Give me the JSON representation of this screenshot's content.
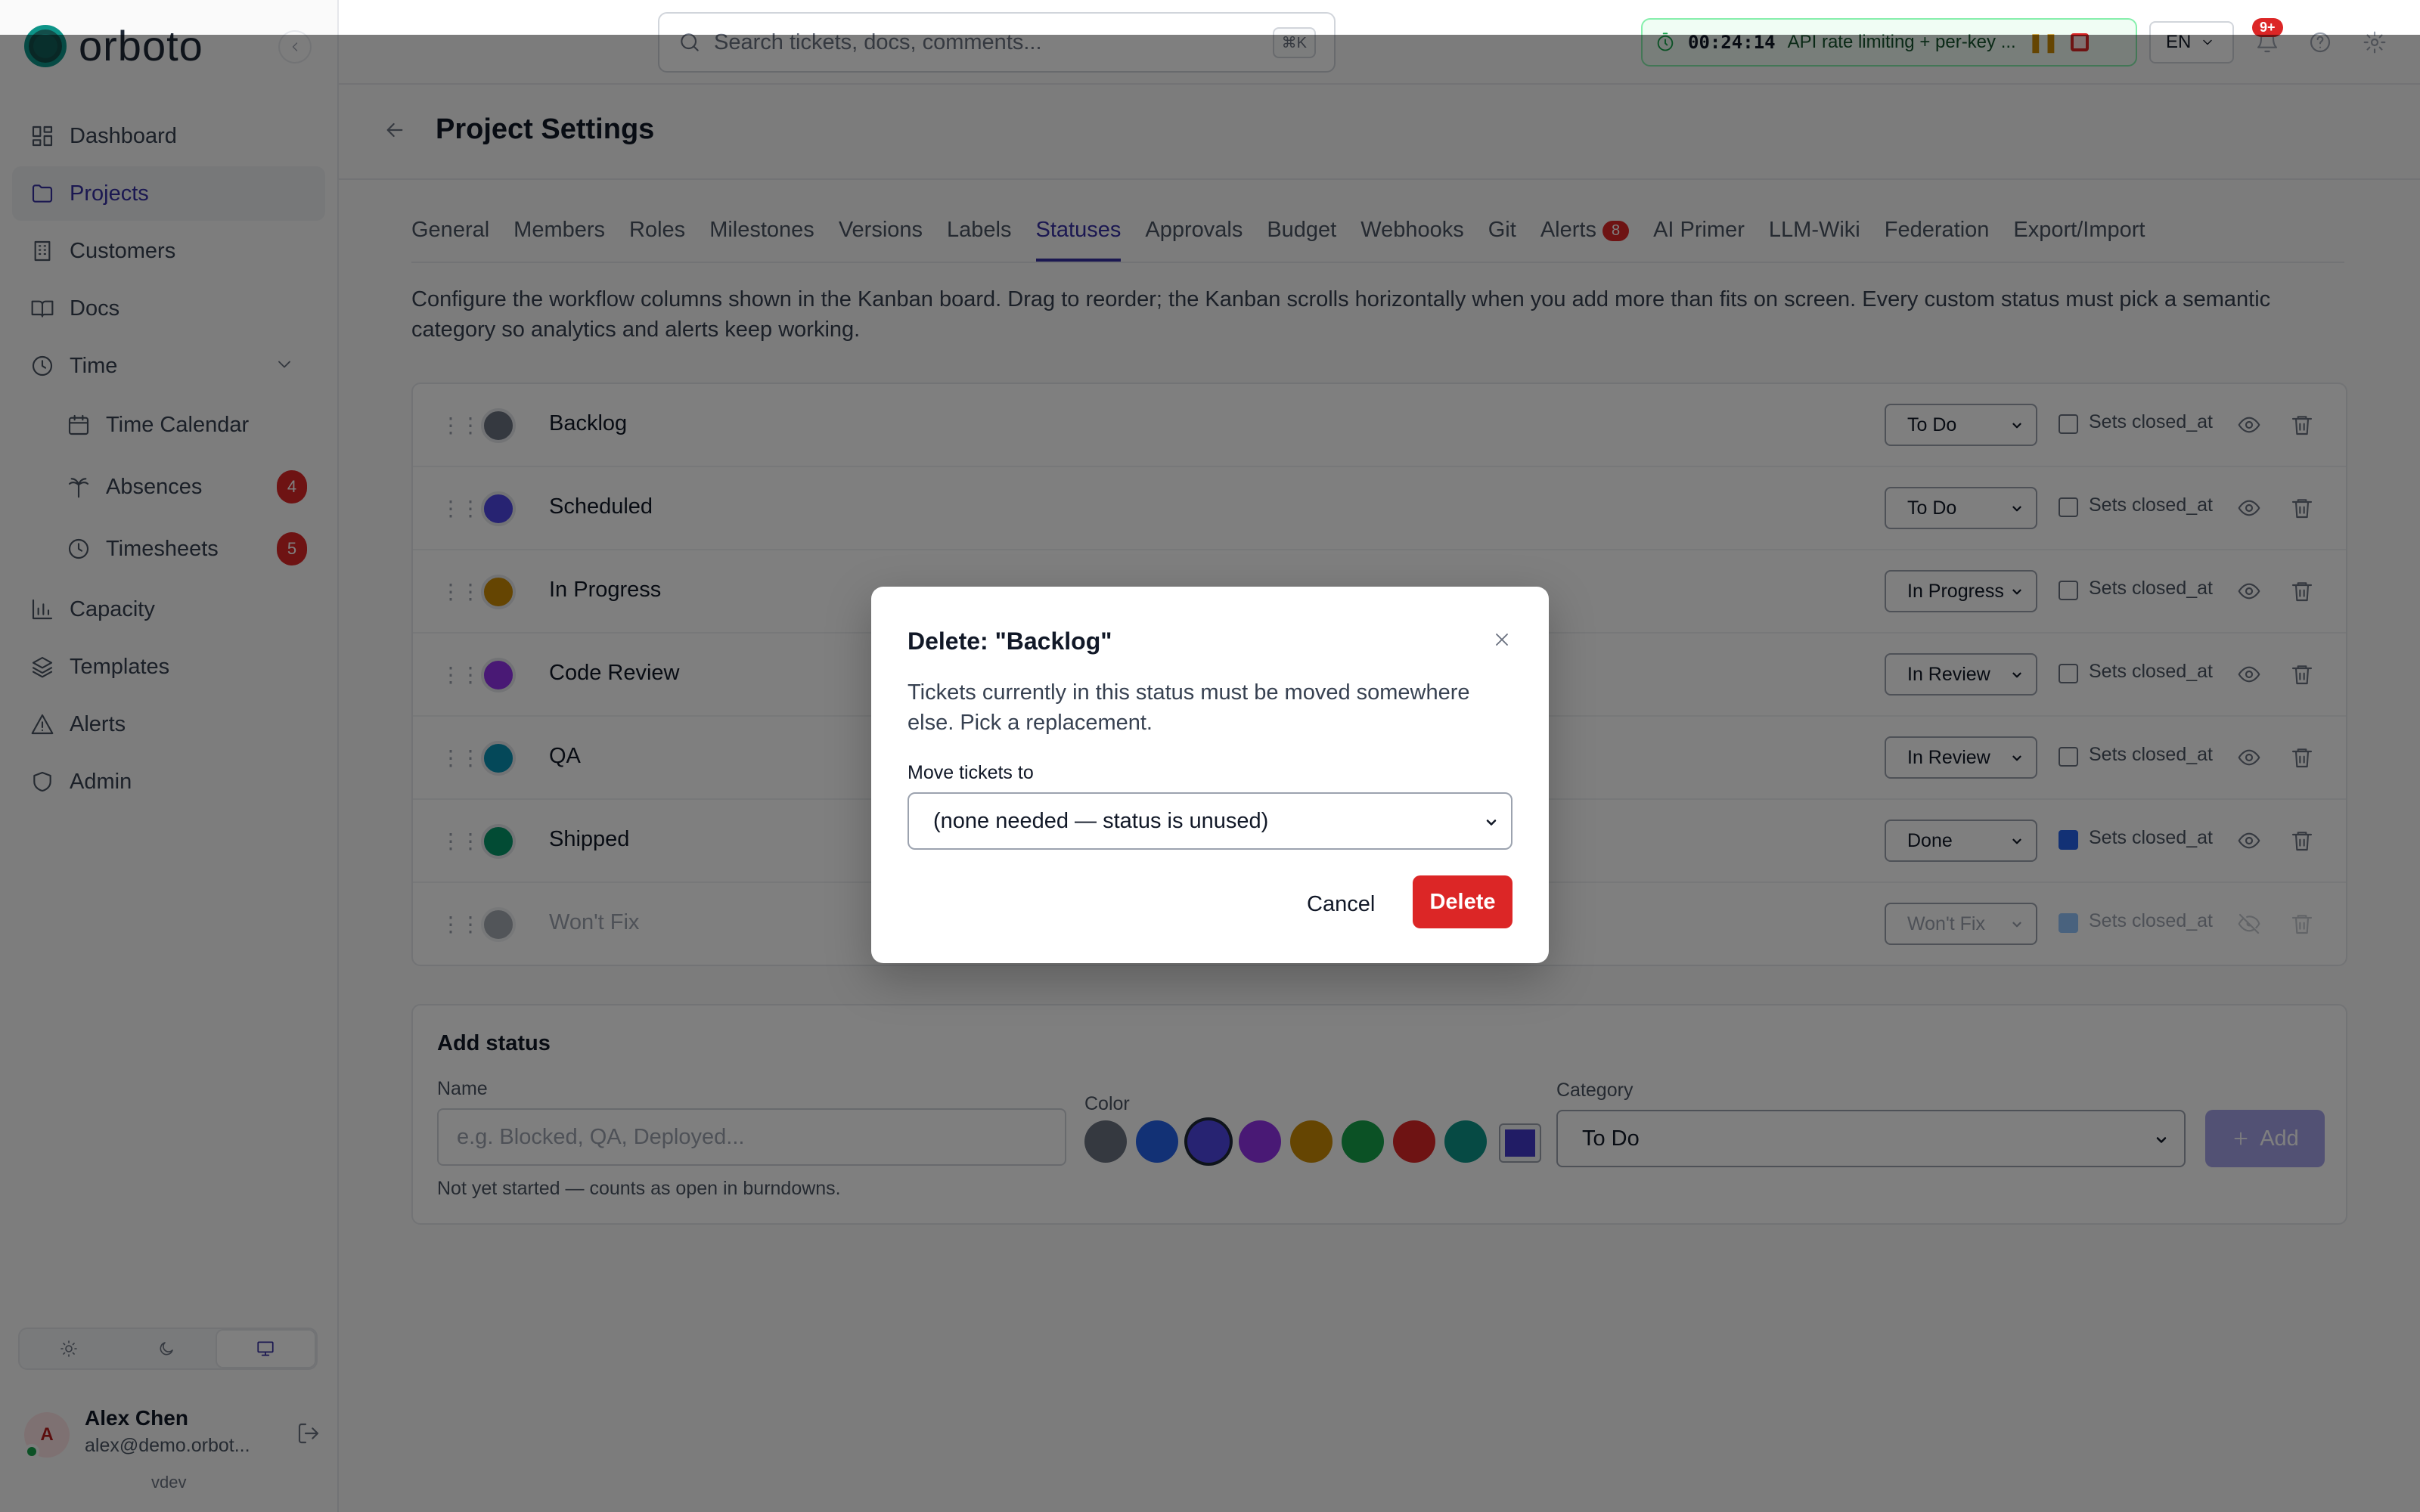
{
  "app": {
    "logo_text": "orboto",
    "version": "vdev"
  },
  "sidebar": {
    "items": [
      {
        "label": "Dashboard",
        "icon": "dashboard-icon"
      },
      {
        "label": "Projects",
        "icon": "folder-icon",
        "active": true
      },
      {
        "label": "Customers",
        "icon": "building-icon"
      },
      {
        "label": "Docs",
        "icon": "book-icon"
      },
      {
        "label": "Time",
        "icon": "clock-icon",
        "expanded": true
      },
      {
        "label": "Time Calendar",
        "icon": "calendar-icon"
      },
      {
        "label": "Absences",
        "icon": "palm-tree-icon",
        "badge": "4"
      },
      {
        "label": "Timesheets",
        "icon": "clock-icon",
        "badge": "5"
      },
      {
        "label": "Capacity",
        "icon": "bar-chart-icon"
      },
      {
        "label": "Templates",
        "icon": "layers-icon"
      },
      {
        "label": "Alerts",
        "icon": "triangle-alert-icon"
      },
      {
        "label": "Admin",
        "icon": "shield-icon"
      }
    ],
    "theme_options": [
      "light",
      "dark",
      "system"
    ],
    "theme_selected": "system",
    "user": {
      "initial": "A",
      "name": "Alex Chen",
      "email": "alex@demo.orbot..."
    }
  },
  "topbar": {
    "search_placeholder": "Search tickets, docs, comments...",
    "search_shortcut": "⌘K",
    "timer": {
      "elapsed": "00:24:14",
      "task": "API rate limiting + per-key ..."
    },
    "language": "EN",
    "notifications_badge": "9+"
  },
  "page": {
    "title": "Project Settings",
    "tabs": [
      {
        "label": "General"
      },
      {
        "label": "Members"
      },
      {
        "label": "Roles"
      },
      {
        "label": "Milestones"
      },
      {
        "label": "Versions"
      },
      {
        "label": "Labels"
      },
      {
        "label": "Statuses",
        "active": true
      },
      {
        "label": "Approvals"
      },
      {
        "label": "Budget"
      },
      {
        "label": "Webhooks"
      },
      {
        "label": "Git"
      },
      {
        "label": "Alerts",
        "count": "8"
      },
      {
        "label": "AI Primer"
      },
      {
        "label": "LLM-Wiki"
      },
      {
        "label": "Federation"
      },
      {
        "label": "Export/Import"
      }
    ],
    "description": "Configure the workflow columns shown in the Kanban board. Drag to reorder; the Kanban scrolls horizontally when you add more than fits on screen. Every custom status must pick a semantic category so analytics and alerts keep working."
  },
  "statuses": {
    "checkbox_label": "Sets closed_at",
    "rows": [
      {
        "name": "Backlog",
        "color": "#6b7280",
        "category": "To Do",
        "closed": false,
        "hidden": false
      },
      {
        "name": "Scheduled",
        "color": "#4f46e5",
        "category": "To Do",
        "closed": false,
        "hidden": false
      },
      {
        "name": "In Progress",
        "color": "#ca8a04",
        "category": "In Progress",
        "closed": false,
        "hidden": false
      },
      {
        "name": "Code Review",
        "color": "#9333ea",
        "category": "In Review",
        "closed": false,
        "hidden": false
      },
      {
        "name": "QA",
        "color": "#0891b2",
        "category": "In Review",
        "closed": false,
        "hidden": false
      },
      {
        "name": "Shipped",
        "color": "#059669",
        "category": "Done",
        "closed": true,
        "hidden": false
      },
      {
        "name": "Won't Fix",
        "color": "#6b7280",
        "category": "Won't Fix",
        "closed": true,
        "hidden": true
      }
    ]
  },
  "add_status": {
    "heading": "Add status",
    "name_label": "Name",
    "name_placeholder": "e.g. Blocked, QA, Deployed...",
    "color_label": "Color",
    "colors": [
      "#6b7280",
      "#2563eb",
      "#4f46e5",
      "#9333ea",
      "#ca8a04",
      "#16a34a",
      "#dc2626",
      "#0d9488"
    ],
    "selected_color": "#4f46e5",
    "custom_color": "#4338ca",
    "category_label": "Category",
    "category_value": "To Do",
    "button_label": "Add",
    "hint": "Not yet started — counts as open in burndowns."
  },
  "modal": {
    "title": "Delete: \"Backlog\"",
    "body": "Tickets currently in this status must be moved somewhere else. Pick a replacement.",
    "field_label": "Move tickets to",
    "field_value": "(none needed — status is unused)",
    "cancel_label": "Cancel",
    "delete_label": "Delete"
  }
}
